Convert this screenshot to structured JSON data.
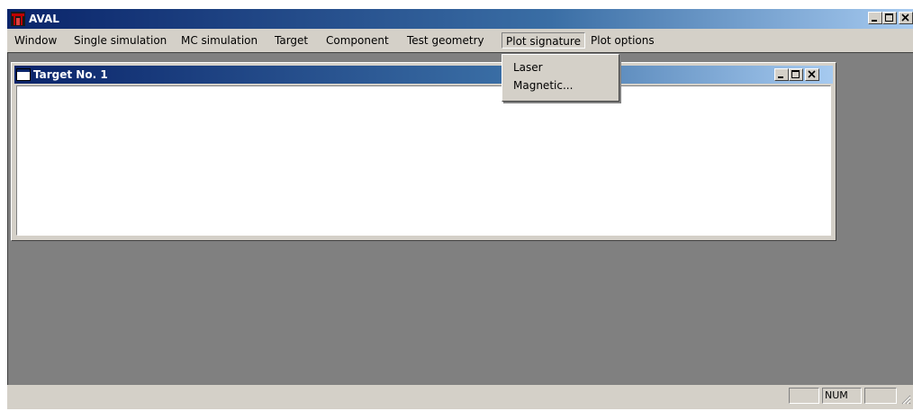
{
  "app": {
    "title": "AVAL"
  },
  "menu": {
    "items": [
      {
        "label": "Window"
      },
      {
        "label": "Single simulation"
      },
      {
        "label": "MC simulation"
      },
      {
        "label": "Target"
      },
      {
        "label": "Component"
      },
      {
        "label": "Test geometry"
      },
      {
        "label": "Plot signature"
      },
      {
        "label": "Plot options"
      }
    ],
    "active_index": 6
  },
  "dropdown": {
    "items": [
      {
        "label": "Laser"
      },
      {
        "label": "Magnetic..."
      }
    ]
  },
  "child_window": {
    "title": "Target No. 1"
  },
  "statusbar": {
    "panels": [
      "",
      "NUM",
      ""
    ]
  },
  "colors": {
    "titlebar_start": "#0a246a",
    "titlebar_end": "#a6caf0",
    "face": "#d4d0c8",
    "mdi_background": "#808080"
  },
  "icons": {
    "app": "aval-app-icon",
    "child": "document-window-icon",
    "minimize": "minimize-icon",
    "maximize": "maximize-icon",
    "close": "close-icon",
    "resize": "resize-grip-icon"
  }
}
